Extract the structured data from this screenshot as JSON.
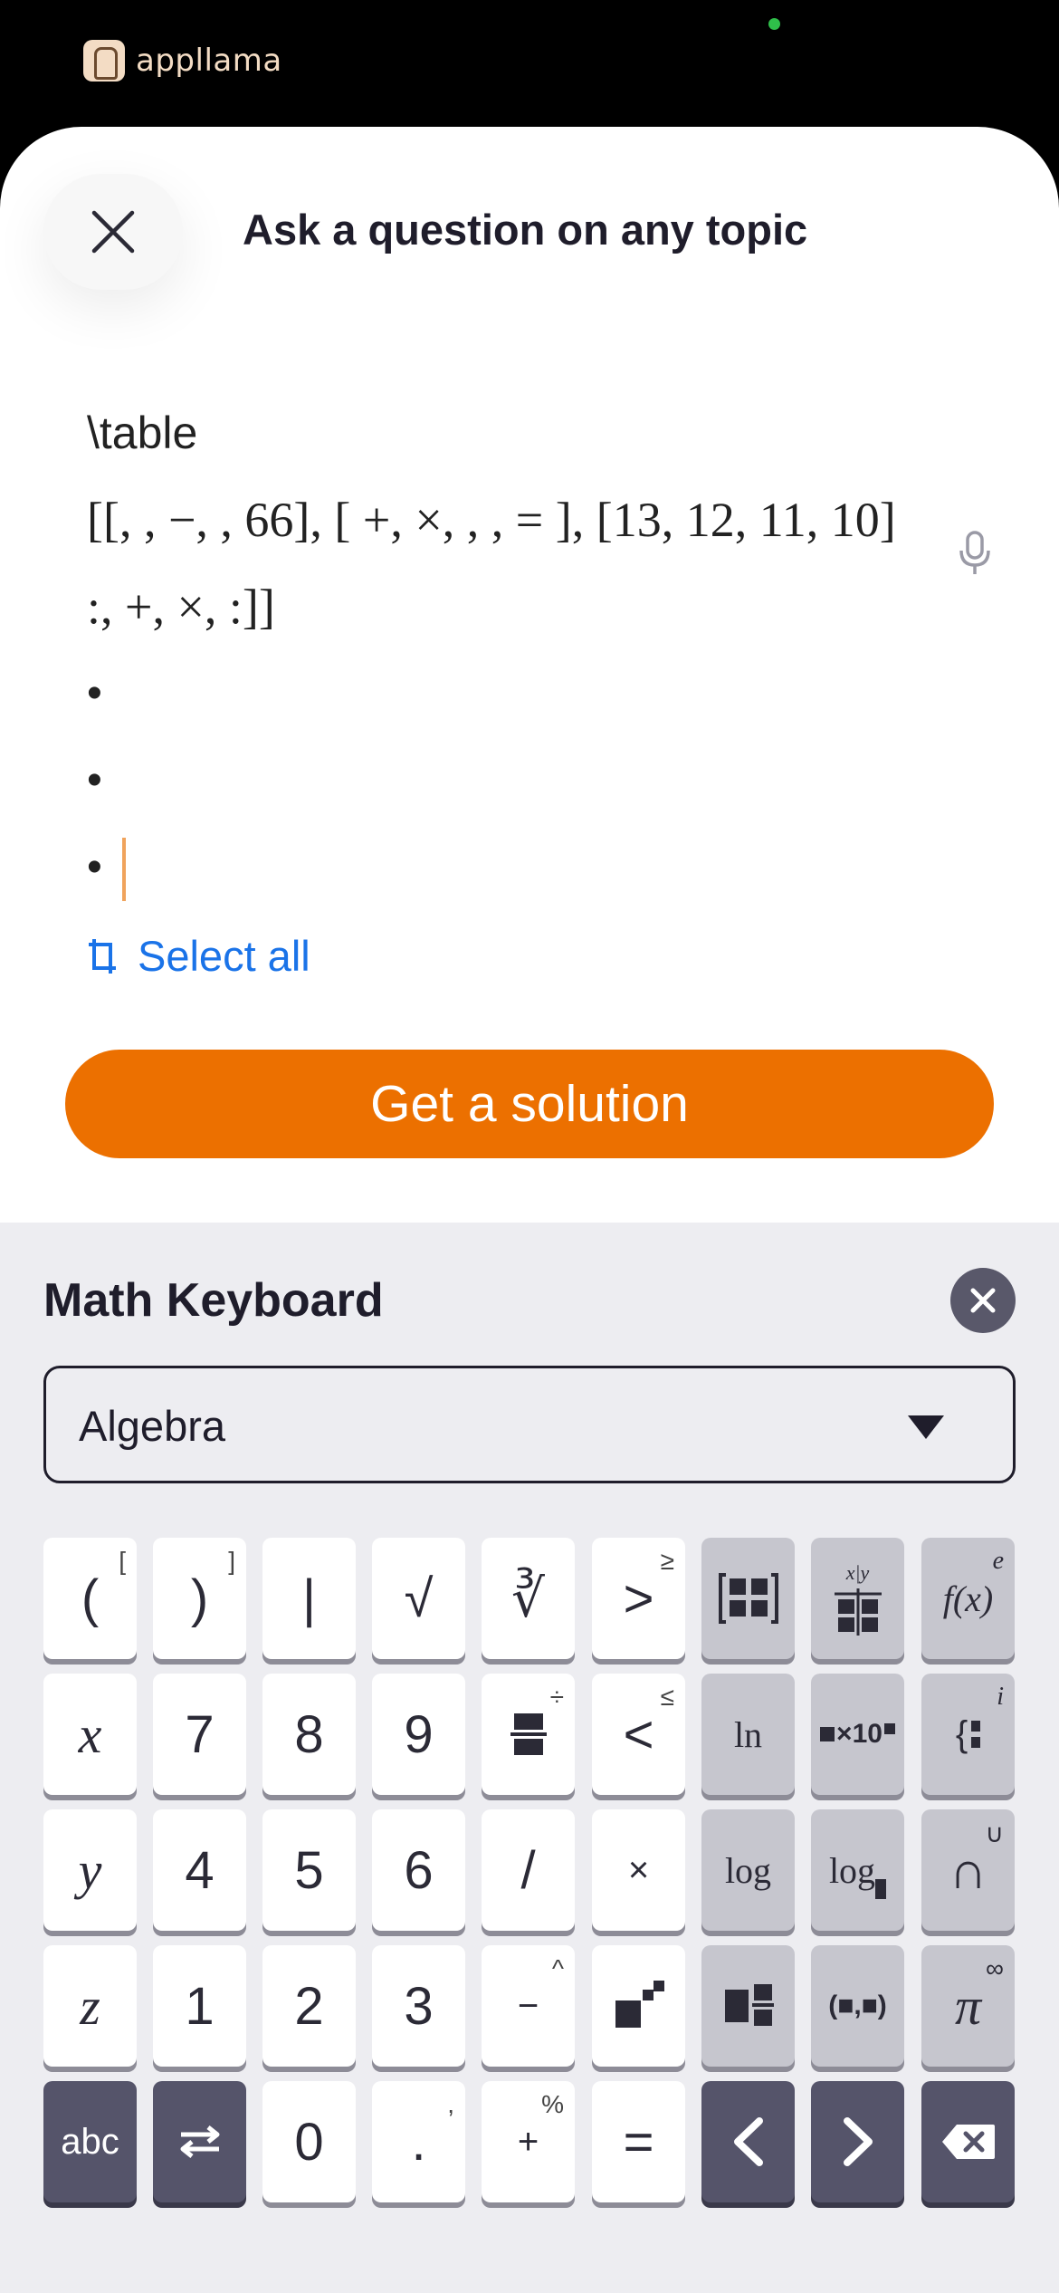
{
  "status_bar": {
    "logo_text": "appllama"
  },
  "header": {
    "title": "Ask a question on any topic"
  },
  "question": {
    "line1": "\\table",
    "line2": "[[, , −, , 66], [ +, ×, , , = ], [13, 12, 11, 10]",
    "line3": ":, +, ×, :]]",
    "bullets": [
      "•",
      "•",
      "•"
    ]
  },
  "select_all": {
    "label": "Select all"
  },
  "solution_button": {
    "label": "Get a solution"
  },
  "math_keyboard": {
    "title": "Math Keyboard",
    "category": "Algebra",
    "rows": [
      [
        {
          "main": "(",
          "sup": "["
        },
        {
          "main": ")",
          "sup": "]"
        },
        {
          "main": "|",
          "sup": ""
        },
        {
          "main": "√",
          "sup": ""
        },
        {
          "main": "∛",
          "sup": ""
        },
        {
          "main": ">",
          "sup": "≥"
        },
        {
          "main": "matrix-icon",
          "sup": ""
        },
        {
          "main": "x|y",
          "sup": ""
        },
        {
          "main": "f(x)",
          "sup": "e"
        }
      ],
      [
        {
          "main": "x",
          "sup": ""
        },
        {
          "main": "7",
          "sup": ""
        },
        {
          "main": "8",
          "sup": ""
        },
        {
          "main": "9",
          "sup": ""
        },
        {
          "main": "fraction-icon",
          "sup": "÷"
        },
        {
          "main": "<",
          "sup": "≤"
        },
        {
          "main": "ln",
          "sup": ""
        },
        {
          "main": "×10",
          "sup": ""
        },
        {
          "main": "{",
          "sup": "i"
        }
      ],
      [
        {
          "main": "y",
          "sup": ""
        },
        {
          "main": "4",
          "sup": ""
        },
        {
          "main": "5",
          "sup": ""
        },
        {
          "main": "6",
          "sup": ""
        },
        {
          "main": "/",
          "sup": ""
        },
        {
          "main": "×",
          "sup": ""
        },
        {
          "main": "log",
          "sup": ""
        },
        {
          "main": "log",
          "sup": ""
        },
        {
          "main": "∩",
          "sup": "∪"
        }
      ],
      [
        {
          "main": "z",
          "sup": ""
        },
        {
          "main": "1",
          "sup": ""
        },
        {
          "main": "2",
          "sup": ""
        },
        {
          "main": "3",
          "sup": ""
        },
        {
          "main": "−",
          "sup": "^"
        },
        {
          "main": "power-icon",
          "sup": ""
        },
        {
          "main": "mixed-fraction-icon",
          "sup": ""
        },
        {
          "main": "(■,■)",
          "sup": ""
        },
        {
          "main": "π",
          "sup": "∞"
        }
      ],
      [
        {
          "main": "abc",
          "sup": ""
        },
        {
          "main": "swap-icon",
          "sup": ""
        },
        {
          "main": "0",
          "sup": ""
        },
        {
          "main": ".",
          "sup": ","
        },
        {
          "main": "+",
          "sup": "%"
        },
        {
          "main": "=",
          "sup": ""
        },
        {
          "main": "left-arrow-icon",
          "sup": ""
        },
        {
          "main": "right-arrow-icon",
          "sup": ""
        },
        {
          "main": "backspace-icon",
          "sup": ""
        }
      ]
    ]
  },
  "colors": {
    "accent": "#ec7000",
    "link": "#1a73e8",
    "key_dark": "#55546a",
    "key_gray": "#c6c6ce"
  }
}
